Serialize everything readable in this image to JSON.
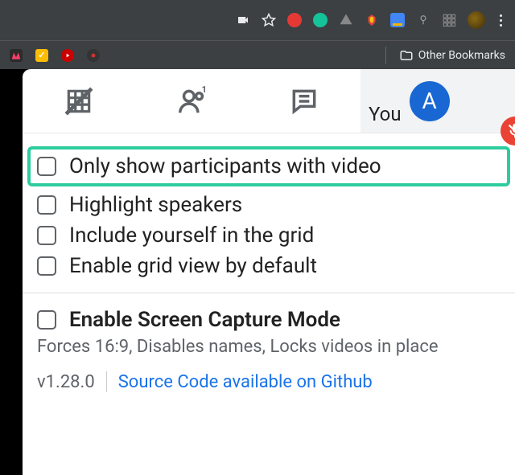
{
  "bookmark_bar": {
    "other_bookmarks": "Other Bookmarks"
  },
  "tabs": {
    "you_label": "You",
    "avatar_letter": "A"
  },
  "options": {
    "only_video": "Only show participants with video",
    "highlight_speakers": "Highlight speakers",
    "include_yourself": "Include yourself in the grid",
    "enable_default": "Enable grid view by default",
    "screen_capture": "Enable Screen Capture Mode",
    "screen_capture_desc": "Forces 16:9, Disables names, Locks videos in place"
  },
  "footer": {
    "version": "v1.28.0",
    "source_link": "Source Code available on Github"
  }
}
